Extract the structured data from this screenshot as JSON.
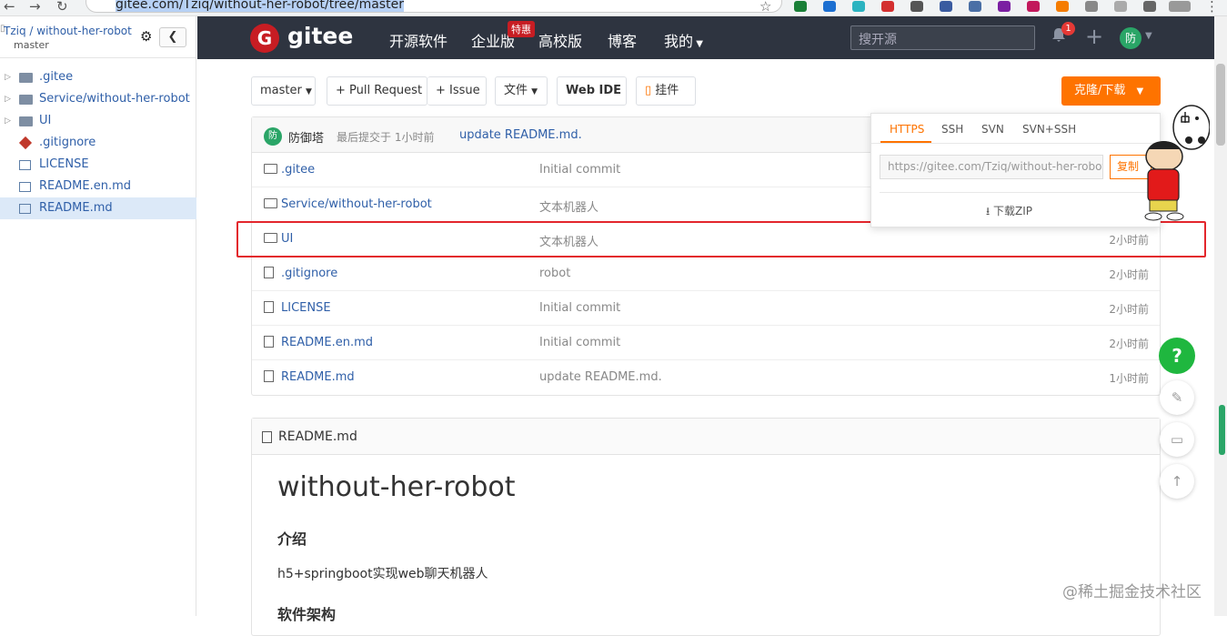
{
  "browser": {
    "url": "gitee.com/Tziq/without-her-robot/tree/master"
  },
  "sidebar": {
    "repo_title": "Tziq / without-her-robot",
    "branch": "master",
    "items": [
      {
        "label": ".gitee",
        "type": "folder"
      },
      {
        "label": "Service/without-her-robot",
        "type": "folder"
      },
      {
        "label": "UI",
        "type": "folder"
      },
      {
        "label": ".gitignore",
        "type": "git"
      },
      {
        "label": "LICENSE",
        "type": "file"
      },
      {
        "label": "README.en.md",
        "type": "file"
      },
      {
        "label": "README.md",
        "type": "file",
        "selected": true
      }
    ]
  },
  "navbar": {
    "logo": "gitee",
    "links": [
      "开源软件",
      "企业版",
      "高校版",
      "博客",
      "我的"
    ],
    "badge": "特惠",
    "search_placeholder": "搜开源",
    "notif_count": "1",
    "avatar": "防"
  },
  "toolbar": {
    "branch": "master",
    "pull_request": "+ Pull Request",
    "issue": "+ Issue",
    "files": "文件",
    "web_ide": "Web IDE",
    "widget": "挂件",
    "clone": "克隆/下载"
  },
  "commit": {
    "avatar": "防",
    "author": "防御塔",
    "meta": "最后提交于 1小时前",
    "message": "update README.md."
  },
  "files": [
    {
      "name": ".gitee",
      "type": "folder",
      "message": "Initial commit",
      "time": ""
    },
    {
      "name": "Service/without-her-robot",
      "type": "folder",
      "message": "文本机器人",
      "time": ""
    },
    {
      "name": "UI",
      "type": "folder",
      "message": "文本机器人",
      "time": "2小时前"
    },
    {
      "name": ".gitignore",
      "type": "file",
      "message": "robot",
      "time": "2小时前"
    },
    {
      "name": "LICENSE",
      "type": "file",
      "message": "Initial commit",
      "time": "2小时前"
    },
    {
      "name": "README.en.md",
      "type": "file",
      "message": "Initial commit",
      "time": "2小时前"
    },
    {
      "name": "README.md",
      "type": "file",
      "message": "update README.md.",
      "time": "1小时前"
    }
  ],
  "clone_dropdown": {
    "tabs": [
      "HTTPS",
      "SSH",
      "SVN",
      "SVN+SSH"
    ],
    "url": "https://gitee.com/Tziq/without-her-robot.git",
    "copy": "复制",
    "zip": "下载ZIP"
  },
  "readme": {
    "filename": "README.md",
    "h1": "without-her-robot",
    "h2_intro": "介绍",
    "intro": "h5+springboot实现web聊天机器人",
    "h2_arch": "软件架构"
  },
  "help": "?",
  "watermark": "@稀土掘金技术社区",
  "colors": {
    "accent": "#fe7300",
    "navbar": "#2e3440",
    "link": "#2f5fa8",
    "highlight": "#e3262c",
    "help": "#1fb73f"
  }
}
